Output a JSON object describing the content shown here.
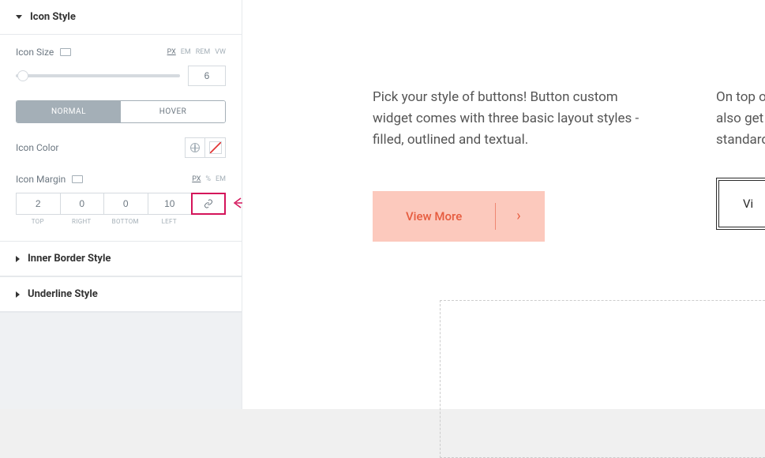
{
  "sections": {
    "icon_style": "Icon Style",
    "inner_border": "Inner Border Style",
    "underline": "Underline Style"
  },
  "icon_size": {
    "label": "Icon Size",
    "units": [
      "PX",
      "EM",
      "REM",
      "VW"
    ],
    "active_unit": "PX",
    "value": "6"
  },
  "state_tabs": {
    "normal": "NORMAL",
    "hover": "HOVER"
  },
  "icon_color": {
    "label": "Icon Color"
  },
  "icon_margin": {
    "label": "Icon Margin",
    "units": [
      "PX",
      "%",
      "EM"
    ],
    "active_unit": "PX",
    "values": {
      "top": "2",
      "right": "0",
      "bottom": "0",
      "left": "10"
    },
    "labels": {
      "top": "TOP",
      "right": "RIGHT",
      "bottom": "BOTTOM",
      "left": "LEFT"
    }
  },
  "preview": {
    "text1": "Pick your style of buttons! Button custom widget comes with three basic layout styles - filled, outlined and textual.",
    "text2_a": "On top o",
    "text2_b": "also get",
    "text2_c": "standard",
    "button1": "View More",
    "button2": "Vi"
  }
}
